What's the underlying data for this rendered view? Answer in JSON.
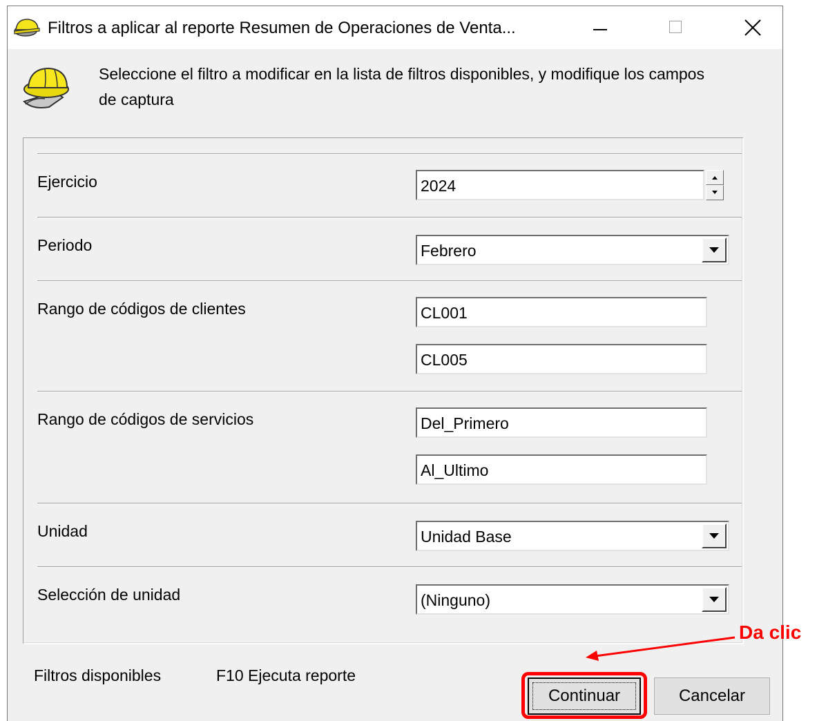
{
  "window": {
    "title": "Filtros a aplicar al reporte Resumen de Operaciones de Venta...",
    "controls": [
      "minimize-icon",
      "maximize-icon",
      "close-icon"
    ]
  },
  "header": {
    "icon": "hardhat-icon",
    "instructions": "Seleccione el filtro a modificar  en la lista de filtros disponibles, y modifique los campos de  captura"
  },
  "filters": {
    "ejercicio": {
      "label": "Ejercicio",
      "value": "2024"
    },
    "periodo": {
      "label": "Periodo",
      "value": "Febrero"
    },
    "clientes": {
      "label": "Rango de códigos de clientes",
      "from": "CL001",
      "to": "CL005"
    },
    "servicios": {
      "label": "Rango de códigos de servicios",
      "from": "Del_Primero",
      "to": "Al_Ultimo"
    },
    "unidad": {
      "label": "Unidad",
      "value": "Unidad Base"
    },
    "seleccion_unidad": {
      "label": "Selección de unidad",
      "value": "(Ninguno)"
    }
  },
  "footer": {
    "filtros_disponibles": "Filtros disponibles",
    "f10": "F10 Ejecuta reporte",
    "continuar": "Continuar",
    "cancelar": "Cancelar"
  },
  "annotation": {
    "text": "Da clic",
    "color": "#ff0000"
  }
}
